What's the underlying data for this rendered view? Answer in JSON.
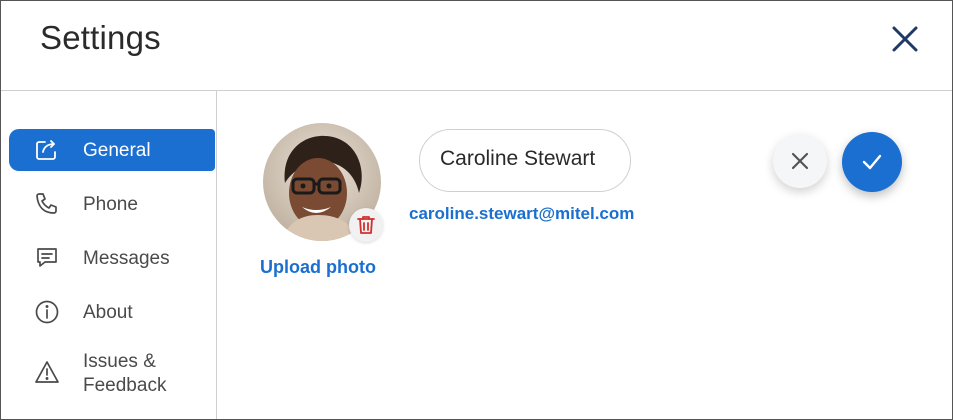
{
  "header": {
    "title": "Settings",
    "close_icon": "close-icon"
  },
  "sidebar": {
    "items": [
      {
        "label": "General",
        "icon": "share-icon",
        "active": true
      },
      {
        "label": "Phone",
        "icon": "phone-icon",
        "active": false
      },
      {
        "label": "Messages",
        "icon": "message-icon",
        "active": false
      },
      {
        "label": "About",
        "icon": "info-icon",
        "active": false
      },
      {
        "label": "Issues &\nFeedback",
        "icon": "warning-icon",
        "active": false
      }
    ]
  },
  "profile": {
    "upload_label": "Upload photo",
    "name_value": "Caroline Stewart",
    "email": "caroline.stewart@mitel.com"
  },
  "colors": {
    "accent": "#1a6fd1",
    "trash_red": "#d0302f",
    "text": "#2a2a2a"
  }
}
